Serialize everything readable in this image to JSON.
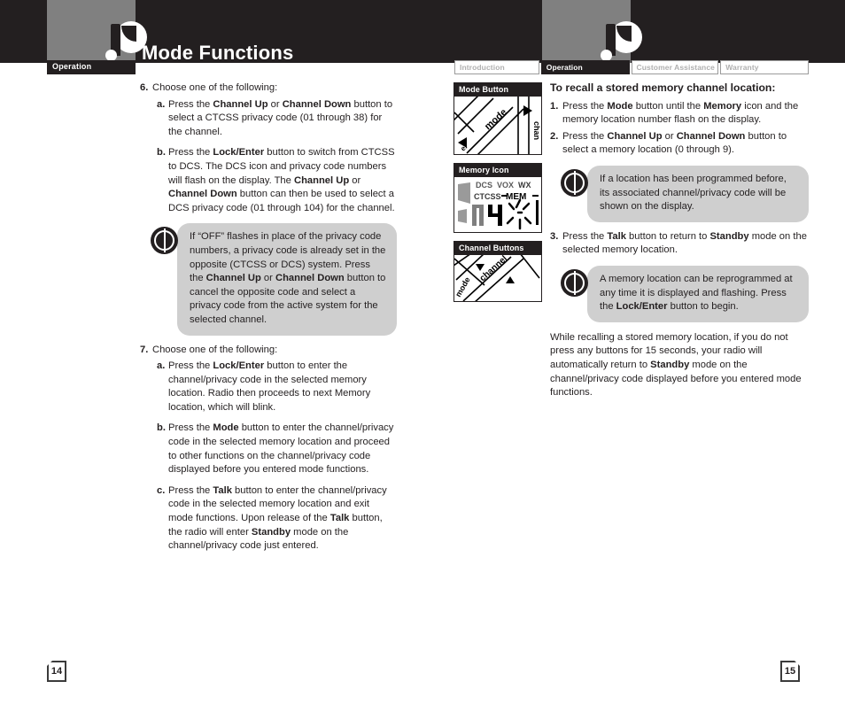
{
  "header": {
    "title": "Mode Functions",
    "chapter_tab_label": "Operation",
    "logo_name": "two-way-radio-logo"
  },
  "nav_tabs": [
    {
      "label": "Introduction",
      "active": false
    },
    {
      "label": "Operation",
      "active": true
    },
    {
      "label": "Customer Assistance",
      "active": false
    },
    {
      "label": "Warranty",
      "active": false
    }
  ],
  "left_page": {
    "page_number": "14",
    "step6": {
      "marker": "6.",
      "text": "Choose one of the following:",
      "items": [
        {
          "marker": "a.",
          "parts": [
            {
              "t": "Press the ",
              "b": false
            },
            {
              "t": "Channel Up",
              "b": true
            },
            {
              "t": " or ",
              "b": false
            },
            {
              "t": "Channel Down",
              "b": true
            },
            {
              "t": " button to select a CTCSS privacy code (01 through 38) for the channel.",
              "b": false
            }
          ]
        },
        {
          "marker": "b.",
          "parts": [
            {
              "t": "Press the ",
              "b": false
            },
            {
              "t": "Lock/Enter",
              "b": true
            },
            {
              "t": " button to switch from CTCSS to DCS. The DCS icon and privacy code numbers will flash on the display. The ",
              "b": false
            },
            {
              "t": "Channel Up",
              "b": true
            },
            {
              "t": " or ",
              "b": false
            },
            {
              "t": "Channel Down",
              "b": true
            },
            {
              "t": " button can then be used to select a DCS privacy code (01 through 104) for the channel.",
              "b": false
            }
          ]
        }
      ]
    },
    "note1": {
      "icon": "info-power-icon",
      "parts": [
        {
          "t": "If “OFF” flashes in place of the privacy code numbers, a privacy code is already set in the opposite (CTCSS or DCS) system. Press the ",
          "b": false
        },
        {
          "t": "Channel Up",
          "b": true
        },
        {
          "t": " or ",
          "b": false
        },
        {
          "t": "Channel Down",
          "b": true
        },
        {
          "t": " button to cancel the opposite code and select a privacy code from the active system for the selected channel.",
          "b": false
        }
      ]
    },
    "step7": {
      "marker": "7.",
      "text": "Choose one of the following:",
      "items": [
        {
          "marker": "a.",
          "parts": [
            {
              "t": "Press the ",
              "b": false
            },
            {
              "t": "Lock/Enter",
              "b": true
            },
            {
              "t": " button to enter the channel/privacy code in the selected memory location. Radio then proceeds to next Memory location, which will blink.",
              "b": false
            }
          ]
        },
        {
          "marker": "b.",
          "parts": [
            {
              "t": "Press the ",
              "b": false
            },
            {
              "t": "Mode",
              "b": true
            },
            {
              "t": " button to enter the channel/privacy code in the selected memory location and proceed to other functions on the channel/privacy code displayed before you entered mode functions.",
              "b": false
            }
          ]
        },
        {
          "marker": "c.",
          "parts": [
            {
              "t": "Press the ",
              "b": false
            },
            {
              "t": "Talk",
              "b": true
            },
            {
              "t": " button to enter the channel/privacy code in the selected memory location and exit mode functions. Upon release of the ",
              "b": false
            },
            {
              "t": "Talk",
              "b": true
            },
            {
              "t": " button, the radio will enter ",
              "b": false
            },
            {
              "t": "Standby",
              "b": true
            },
            {
              "t": " mode on the channel/privacy code just entered.",
              "b": false
            }
          ]
        }
      ]
    }
  },
  "right_page": {
    "page_number": "15",
    "figures": [
      {
        "caption": "Mode Button",
        "art": "mode-button-diagram",
        "labels": [
          "mode",
          "channel"
        ]
      },
      {
        "caption": "Memory Icon",
        "art": "lcd-memory-icon",
        "labels": [
          "DCS",
          "VOX",
          "WX",
          "CTCSS",
          "MEM",
          "04"
        ]
      },
      {
        "caption": "Channel Buttons",
        "art": "channel-buttons-diagram",
        "labels": [
          "channel",
          "mode"
        ]
      }
    ],
    "subhead": "To recall a stored memory channel location:",
    "steps": [
      {
        "marker": "1.",
        "parts": [
          {
            "t": "Press the ",
            "b": false
          },
          {
            "t": "Mode",
            "b": true
          },
          {
            "t": " button until the ",
            "b": false
          },
          {
            "t": "Memory",
            "b": true
          },
          {
            "t": " icon and the memory location number flash on the display.",
            "b": false
          }
        ]
      },
      {
        "marker": "2.",
        "parts": [
          {
            "t": "Press the ",
            "b": false
          },
          {
            "t": "Channel Up",
            "b": true
          },
          {
            "t": " or ",
            "b": false
          },
          {
            "t": "Channel Down",
            "b": true
          },
          {
            "t": " button to select a memory location (0 through 9).",
            "b": false
          }
        ]
      }
    ],
    "note1": {
      "icon": "info-power-icon",
      "parts": [
        {
          "t": "If a location has been programmed before, its associated channel/privacy code will be shown on the display.",
          "b": false
        }
      ]
    },
    "step3": {
      "marker": "3.",
      "parts": [
        {
          "t": "Press the ",
          "b": false
        },
        {
          "t": "Talk",
          "b": true
        },
        {
          "t": " button to return to ",
          "b": false
        },
        {
          "t": "Standby",
          "b": true
        },
        {
          "t": " mode on the selected memory location.",
          "b": false
        }
      ]
    },
    "note2": {
      "icon": "info-power-icon",
      "parts": [
        {
          "t": "A memory location can be reprogrammed at any time it is displayed and flashing. Press the ",
          "b": false
        },
        {
          "t": "Lock/Enter",
          "b": true
        },
        {
          "t": " button to begin.",
          "b": false
        }
      ]
    },
    "closing": {
      "parts": [
        {
          "t": "While recalling a stored memory location, if you do not press any buttons for 15 seconds, your radio will automatically return to ",
          "b": false
        },
        {
          "t": "Standby",
          "b": true
        },
        {
          "t": " mode on the channel/privacy code displayed before you entered mode functions.",
          "b": false
        }
      ]
    }
  },
  "colors": {
    "ink": "#231f20",
    "header_gray": "#808080",
    "note_gray": "#cfcfcf",
    "tab_inactive_text": "#b0b0b0"
  }
}
